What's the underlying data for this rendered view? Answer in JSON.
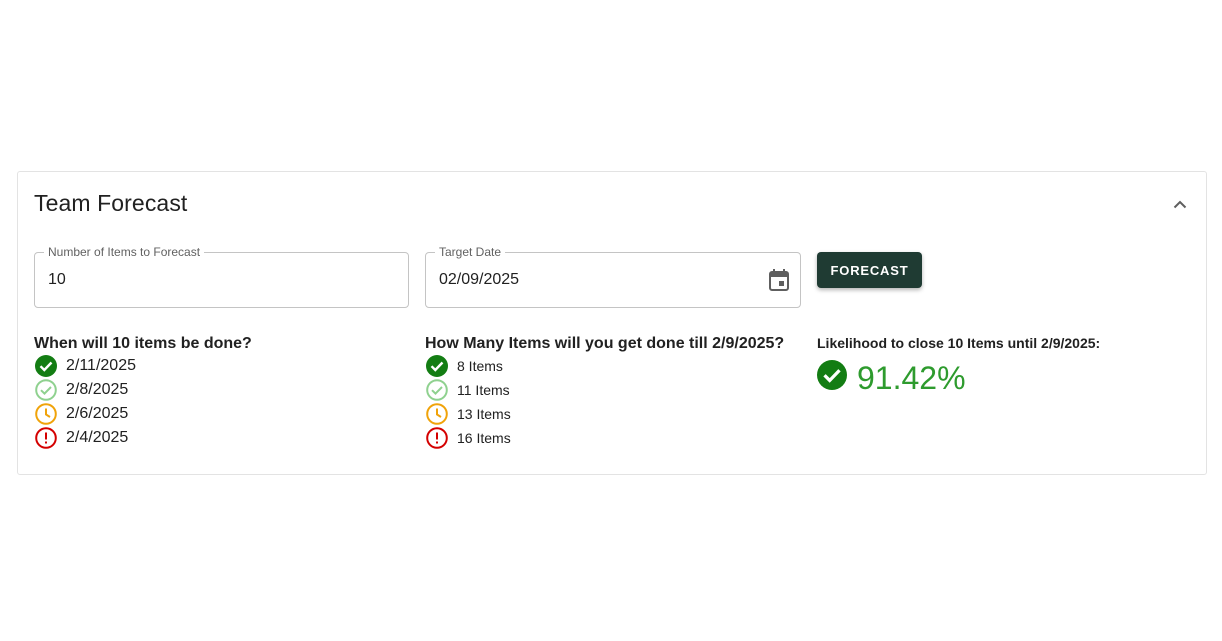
{
  "panel": {
    "title": "Team Forecast"
  },
  "inputs": {
    "items_label": "Number of Items to Forecast",
    "items_value": "10",
    "date_label": "Target Date",
    "date_value": "02/09/2025"
  },
  "forecast_button": {
    "label": "FORECAST"
  },
  "when_section": {
    "heading": "When will 10 items be done?",
    "rows": [
      {
        "icon": "check-circle-filled-icon",
        "text": "2/11/2025"
      },
      {
        "icon": "check-circle-outline-icon",
        "text": "2/8/2025"
      },
      {
        "icon": "clock-icon",
        "text": "2/6/2025"
      },
      {
        "icon": "error-icon",
        "text": "2/4/2025"
      }
    ]
  },
  "howmany_section": {
    "heading": "How Many Items will you get done till 2/9/2025?",
    "rows": [
      {
        "icon": "check-circle-filled-icon",
        "text": "8 Items"
      },
      {
        "icon": "check-circle-outline-icon",
        "text": "11 Items"
      },
      {
        "icon": "clock-icon",
        "text": "13 Items"
      },
      {
        "icon": "error-icon",
        "text": "16 Items"
      }
    ]
  },
  "likelihood_section": {
    "heading": "Likelihood to close 10 Items until 2/9/2025:",
    "value": "91.42%",
    "icon": "check-circle-filled-icon"
  },
  "colors": {
    "primary_button": "#1f3b33",
    "certain_green": "#137d13",
    "likely_green": "#8fd18f",
    "warning_orange": "#f0a30a",
    "danger_red": "#d40000",
    "likelihood_text": "#2e9b2e"
  }
}
